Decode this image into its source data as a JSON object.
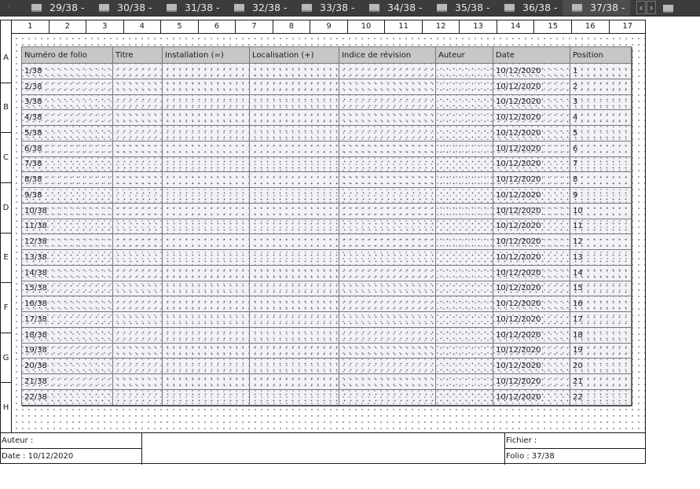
{
  "tabbar": {
    "lead": "·",
    "tabs": [
      {
        "label": "29/38 -"
      },
      {
        "label": "30/38 -"
      },
      {
        "label": "31/38 -"
      },
      {
        "label": "32/38 -"
      },
      {
        "label": "33/38 -"
      },
      {
        "label": "34/38 -"
      },
      {
        "label": "35/38 -"
      },
      {
        "label": "36/38 -"
      },
      {
        "label": "37/38 -"
      }
    ],
    "active_tab": "37/38 -",
    "prev_icon": "‹",
    "next_icon": "›",
    "icon_name": "document-icon"
  },
  "rulers": {
    "columns": [
      "1",
      "2",
      "3",
      "4",
      "5",
      "6",
      "7",
      "8",
      "9",
      "10",
      "11",
      "12",
      "13",
      "14",
      "15",
      "16",
      "17"
    ],
    "rows": [
      "A",
      "B",
      "C",
      "D",
      "E",
      "F",
      "G",
      "H"
    ]
  },
  "table": {
    "headers": [
      "Numéro de folio",
      "Titre",
      "Installation (=)",
      "Localisation (+)",
      "Indice de révision",
      "Auteur",
      "Date",
      "Position"
    ],
    "rows": [
      [
        "1/38",
        "",
        "",
        "",
        "",
        "",
        "10/12/2020",
        "1"
      ],
      [
        "2/38",
        "",
        "",
        "",
        "",
        "",
        "10/12/2020",
        "2"
      ],
      [
        "3/38",
        "",
        "",
        "",
        "",
        "",
        "10/12/2020",
        "3"
      ],
      [
        "4/38",
        "",
        "",
        "",
        "",
        "",
        "10/12/2020",
        "4"
      ],
      [
        "5/38",
        "",
        "",
        "",
        "",
        "",
        "10/12/2020",
        "5"
      ],
      [
        "6/38",
        "",
        "",
        "",
        "",
        "",
        "10/12/2020",
        "6"
      ],
      [
        "7/38",
        "",
        "",
        "",
        "",
        "",
        "10/12/2020",
        "7"
      ],
      [
        "8/38",
        "",
        "",
        "",
        "",
        "",
        "10/12/2020",
        "8"
      ],
      [
        "9/38",
        "",
        "",
        "",
        "",
        "",
        "10/12/2020",
        "9"
      ],
      [
        "10/38",
        "",
        "",
        "",
        "",
        "",
        "10/12/2020",
        "10"
      ],
      [
        "11/38",
        "",
        "",
        "",
        "",
        "",
        "10/12/2020",
        "11"
      ],
      [
        "12/38",
        "",
        "",
        "",
        "",
        "",
        "10/12/2020",
        "12"
      ],
      [
        "13/38",
        "",
        "",
        "",
        "",
        "",
        "10/12/2020",
        "13"
      ],
      [
        "14/38",
        "",
        "",
        "",
        "",
        "",
        "10/12/2020",
        "14"
      ],
      [
        "15/38",
        "",
        "",
        "",
        "",
        "",
        "10/12/2020",
        "15"
      ],
      [
        "16/38",
        "",
        "",
        "",
        "",
        "",
        "10/12/2020",
        "16"
      ],
      [
        "17/38",
        "",
        "",
        "",
        "",
        "",
        "10/12/2020",
        "17"
      ],
      [
        "18/38",
        "",
        "",
        "",
        "",
        "",
        "10/12/2020",
        "18"
      ],
      [
        "19/38",
        "",
        "",
        "",
        "",
        "",
        "10/12/2020",
        "19"
      ],
      [
        "20/38",
        "",
        "",
        "",
        "",
        "",
        "10/12/2020",
        "20"
      ],
      [
        "21/38",
        "",
        "",
        "",
        "",
        "",
        "10/12/2020",
        "21"
      ],
      [
        "22/38",
        "",
        "",
        "",
        "",
        "",
        "10/12/2020",
        "22"
      ]
    ]
  },
  "titleblock": {
    "author": "Auteur :",
    "date": "Date : 10/12/2020",
    "file": "Fichier :",
    "folio": "Folio : 37/38"
  },
  "colors": {
    "tabbar_bg": "#3c3c3c",
    "header_bg": "#c7c7c7",
    "row_tint": "#e6e6f0"
  }
}
